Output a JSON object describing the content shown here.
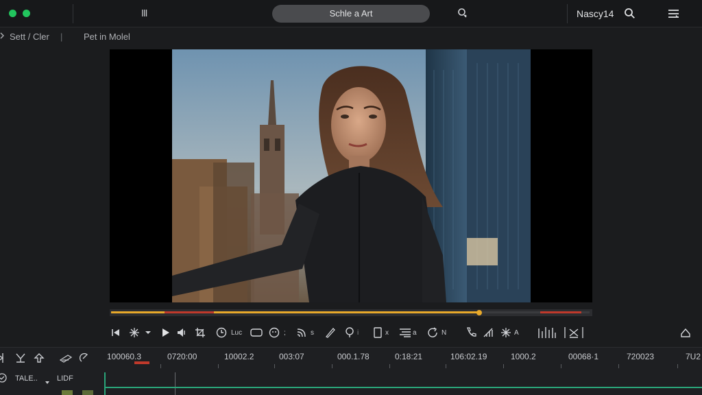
{
  "topbar": {
    "title": "Schle a Art",
    "user": "Nascy14",
    "grip_icon": "III"
  },
  "breadcrumb": {
    "left": "Sett / Cler",
    "right": "Pet in Molel",
    "sep": "|"
  },
  "controls": {
    "labels": [
      "Luc",
      ";",
      "s",
      "i",
      "x",
      "a",
      "N",
      "A"
    ]
  },
  "playback": {
    "progress": 0.77
  },
  "timeline": {
    "timecodes": [
      "100060.3",
      "0720:00",
      "10002.2",
      "003:07",
      "000.1.78",
      "0:18:21",
      "106:02.19",
      "1000.2",
      "00068·1",
      "720023",
      "7U2"
    ],
    "track_labels": [
      "TALE..",
      "LIDF"
    ]
  },
  "colors": {
    "accent_green": "#22c55e",
    "progress_fill": "#e8a92a",
    "progress_red": "#c0392b",
    "track_line": "#2aa57a"
  }
}
